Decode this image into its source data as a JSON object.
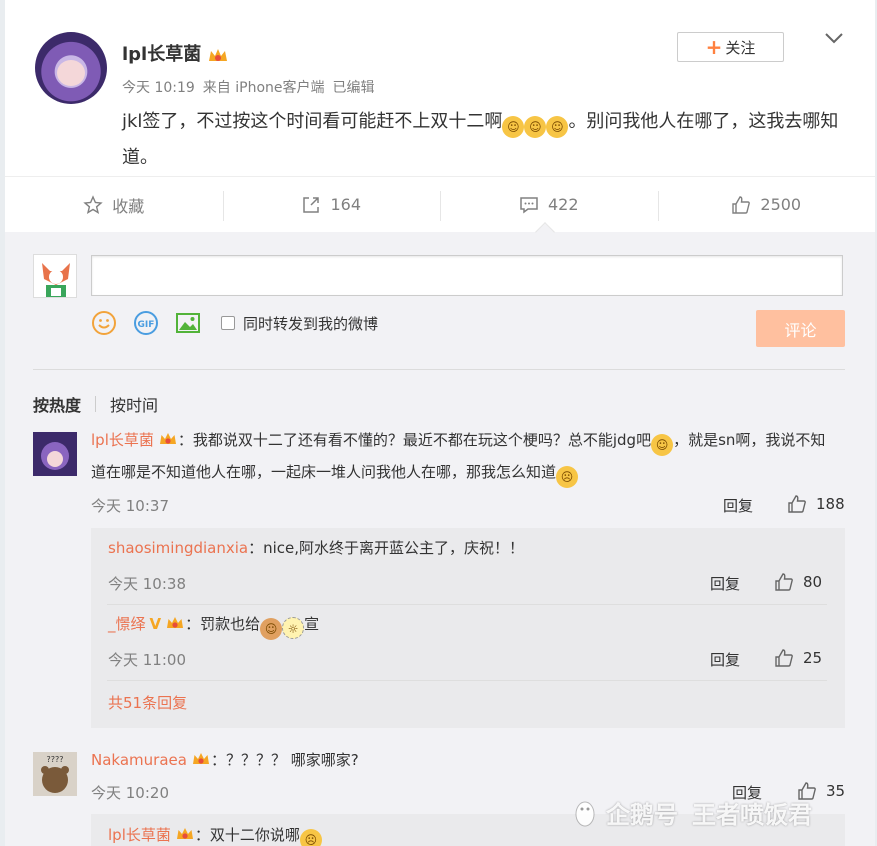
{
  "post": {
    "username": "lpl长草菌",
    "time": "今天 10:19",
    "source": "来自 iPhone客户端",
    "edited": "已编辑",
    "text_part1": "jkl签了，不过按这个时间看可能赶不上双十二啊",
    "text_part2": "。别问我他人在哪了，这我去哪知道。",
    "follow_label": "关注"
  },
  "actions": {
    "favorite": "收藏",
    "repost": "164",
    "comment": "422",
    "like": "2500"
  },
  "composer": {
    "input_value": "",
    "forward_label": "同时转发到我的微博",
    "submit_label": "评论"
  },
  "sort": {
    "hot": "按热度",
    "time": "按时间"
  },
  "comments": [
    {
      "user": "lpl长草菌",
      "text_a": "：我都说双十二了还有看不懂的？最近不都在玩这个梗吗？总不能jdg吧",
      "text_b": "，就是sn啊，我说不知道在哪是不知道他人在哪，一起床一堆人问我他人在哪，那我怎么知道",
      "time": "今天 10:37",
      "reply": "回复",
      "likes": "188",
      "replies": [
        {
          "user": "shaosimingdianxia",
          "text": "：nice,阿水终于离开蓝公主了，庆祝！！",
          "time": "今天 10:38",
          "reply": "回复",
          "likes": "80"
        },
        {
          "user": "_憬绎",
          "text_a": "：罚款也给",
          "text_b": "宣",
          "time": "今天 11:00",
          "reply": "回复",
          "likes": "25"
        }
      ],
      "more": "共51条回复"
    },
    {
      "user": "Nakamuraea",
      "text": "：？？？？ 哪家哪家?",
      "time": "今天 10:20",
      "reply": "回复",
      "likes": "35",
      "replies": [
        {
          "user": "lpl长草菌",
          "text": "：双十二你说哪"
        }
      ]
    }
  ],
  "watermark": {
    "platform": "企鹅号",
    "author": "王者喷饭君"
  }
}
